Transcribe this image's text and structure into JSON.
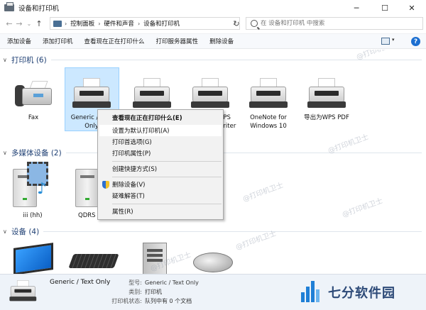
{
  "window": {
    "title": "设备和打印机",
    "minimize": "─",
    "maximize": "☐",
    "close": "✕"
  },
  "nav": {
    "back": "←",
    "forward": "→",
    "recent": "⌄",
    "up": "↑"
  },
  "address": {
    "crumbs": [
      "控制面板",
      "硬件和声音",
      "设备和打印机"
    ],
    "separator": "›",
    "dropdown": "⌄",
    "refresh": "↻"
  },
  "search": {
    "placeholder": "在 设备和打印机 中搜索"
  },
  "commands": [
    "添加设备",
    "添加打印机",
    "查看现在正在打印什么",
    "打印服务器属性",
    "删除设备"
  ],
  "view": {
    "dropdown": "▾",
    "help": "?"
  },
  "groups": {
    "printers": {
      "label": "打印机 (6)",
      "chevron": "∨"
    },
    "media": {
      "label": "多媒体设备 (2)",
      "chevron": "∨"
    },
    "devices": {
      "label": "设备 (4)",
      "chevron": "∨"
    }
  },
  "printers": [
    {
      "name": "Fax"
    },
    {
      "name": "Generic / Text Only"
    },
    {
      "name": ""
    },
    {
      "name": "Microsoft XPS Document Writer"
    },
    {
      "name": "OneNote for Windows 10"
    },
    {
      "name": "导出为WPS PDF"
    }
  ],
  "media": [
    {
      "name": "iii (hh)"
    },
    {
      "name": "QDRS"
    }
  ],
  "context_menu": {
    "items": [
      "查看现在正在打印什么(E)",
      "设置为默认打印机(A)",
      "打印首选项(G)",
      "打印机属性(P)",
      "创建快捷方式(S)",
      "删除设备(V)",
      "疑难解答(T)",
      "属性(R)"
    ]
  },
  "details": {
    "name": "Generic / Text Only",
    "model_label": "型号:",
    "model_value": "Generic / Text Only",
    "category_label": "类别:",
    "category_value": "打印机",
    "status_label": "打印机状态:",
    "status_value": "队列中有 0 个文档"
  },
  "watermark": "@打印机卫士",
  "brand": "七分软件园",
  "colors": {
    "accent": "#1c6fd1",
    "selection": "#cce8ff",
    "group_header": "#1e3f73"
  }
}
